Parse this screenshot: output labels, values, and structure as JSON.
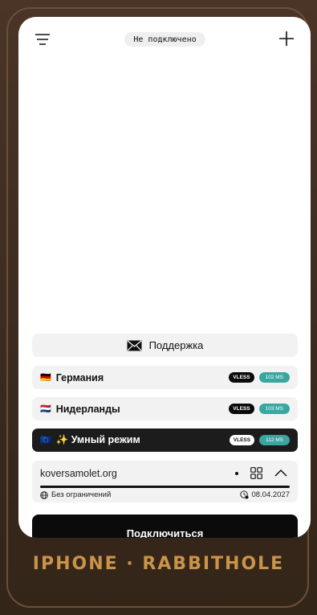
{
  "header": {
    "status": "Не подключено",
    "menu_icon": "menu-icon",
    "add_icon": "plus-icon"
  },
  "support": {
    "label": "Поддержка",
    "icon": "envelope-icon"
  },
  "servers": [
    {
      "flag": "🇩🇪",
      "name": "Германия",
      "protocol": "VLESS",
      "ping": "102 MS"
    },
    {
      "flag": "🇳🇱",
      "name": "Нидерланды",
      "protocol": "VLESS",
      "ping": "103 MS"
    },
    {
      "flag": "🇪🇺",
      "name": "✨ Умный режим",
      "protocol": "VLESS",
      "ping": "112 MS",
      "selected": true
    }
  ],
  "subscription": {
    "domain": "koversamolet.org",
    "traffic_limit": "Без ограничений",
    "expiry": "08.04.2027",
    "usage_fraction": 1.0
  },
  "connect_label": "Подключиться",
  "caption": "IPHONE · RABBITHOLE",
  "colors": {
    "accent": "#3aa6a0",
    "caption": "#c9944a",
    "frame": "#3a2a1f"
  }
}
